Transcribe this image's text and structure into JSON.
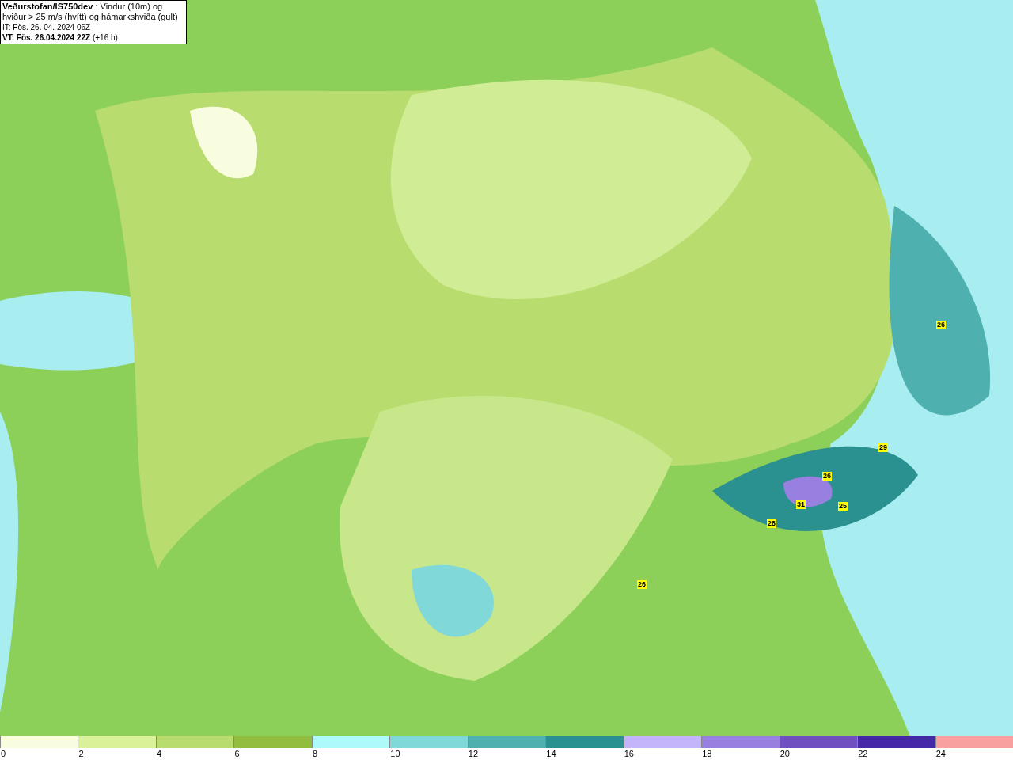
{
  "title_box": {
    "lines": [
      "**Veðurstofan/IS750dev** : Vindur (10m) og hviður > 25 m/s (hvítt) og hámarkshviða (gult)",
      "IT: Fös. 26. 04. 2024 06Z",
      "**VT: Fös. 26.04.2024 22Z** (+16 h)"
    ]
  },
  "gust_labels": [
    "26",
    "29",
    "26",
    "31",
    "25",
    "28",
    "26"
  ],
  "colorbar": [
    {
      "tick": "0",
      "color": "#f8fde0"
    },
    {
      "tick": "2",
      "color": "#d9f29a"
    },
    {
      "tick": "4",
      "color": "#b8dc6e"
    },
    {
      "tick": "6",
      "color": "#92bd3e"
    },
    {
      "tick": "8",
      "color": "#aefafa"
    },
    {
      "tick": "10",
      "color": "#80d8d8"
    },
    {
      "tick": "12",
      "color": "#4fb0b0"
    },
    {
      "tick": "14",
      "color": "#2a9090"
    },
    {
      "tick": "16",
      "color": "#c4b4fa"
    },
    {
      "tick": "18",
      "color": "#9880e0"
    },
    {
      "tick": "20",
      "color": "#7050c0"
    },
    {
      "tick": "22",
      "color": "#4428a8"
    },
    {
      "tick": "24",
      "color": "#f8a0a0"
    }
  ]
}
